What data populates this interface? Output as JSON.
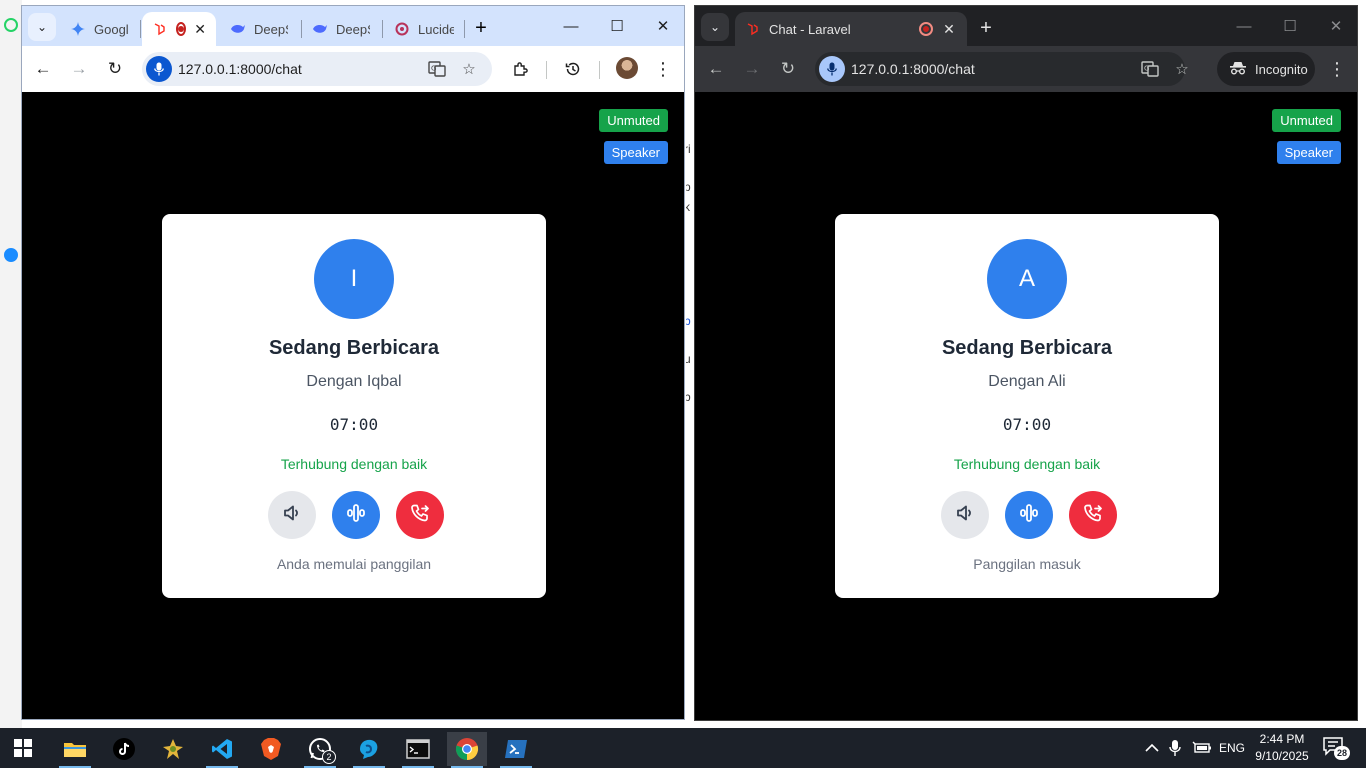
{
  "left_window": {
    "tabs": [
      {
        "label": "Googl",
        "icon": "gemini-icon"
      },
      {
        "label": "",
        "icon": "laravel-icon",
        "active": true
      },
      {
        "label": "DeepS",
        "icon": "deepseek-icon"
      },
      {
        "label": "DeepS",
        "icon": "deepseek-icon"
      },
      {
        "label": "Lucide",
        "icon": "lucide-icon"
      }
    ],
    "url": "127.0.0.1:8000/chat",
    "page": {
      "badges": {
        "mute": "Unmuted",
        "speaker": "Speaker"
      },
      "avatar_letter": "I",
      "title": "Sedang Berbicara",
      "subtitle": "Dengan Iqbal",
      "timer": "07:00",
      "status": "Terhubung dengan baik",
      "note": "Anda memulai panggilan"
    }
  },
  "right_window": {
    "tabs": [
      {
        "label": "Chat - Laravel",
        "icon": "laravel-icon",
        "active": true
      }
    ],
    "url": "127.0.0.1:8000/chat",
    "incognito_label": "Incognito",
    "page": {
      "badges": {
        "mute": "Unmuted",
        "speaker": "Speaker"
      },
      "avatar_letter": "A",
      "title": "Sedang Berbicara",
      "subtitle": "Dengan Ali",
      "timer": "07:00",
      "status": "Terhubung dengan baik",
      "note": "Panggilan masuk"
    }
  },
  "taskbar": {
    "apps": [
      "file-explorer-icon",
      "tiktok-icon",
      "game-icon",
      "vscode-icon",
      "brave-icon",
      "whatsapp-icon",
      "app-icon",
      "terminal-icon",
      "chrome-icon",
      "powershell-icon"
    ],
    "whatsapp_badge": "2",
    "language": "ENG",
    "time": "2:44 PM",
    "date": "9/10/2025",
    "notification_count": "28"
  },
  "colors": {
    "accent_blue": "#2f80ed",
    "success_green": "#16a34a",
    "danger_red": "#ef2d3e"
  }
}
